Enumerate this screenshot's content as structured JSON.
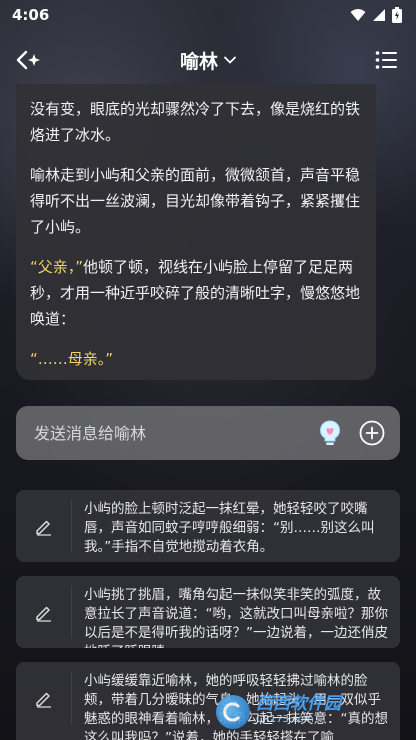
{
  "status": {
    "time": "4:06"
  },
  "header": {
    "title": "喻林"
  },
  "chat": {
    "paragraphs": [
      {
        "text": "没有变，眼底的光却骤然冷了下去，像是烧红的铁烙进了冰水。",
        "style": "normal"
      },
      {
        "text": "喻林走到小屿和父亲的面前，微微颔首，声音平稳得听不出一丝波澜，目光却像带着钩子，紧紧攫住了小屿。",
        "style": "normal"
      },
      {
        "quote": "“父亲，”",
        "text": "他顿了顿，视线在小屿脸上停留了足足两秒，才用一种近乎咬碎了般的清晰吐字，慢悠悠地唤道：",
        "style": "mixed"
      },
      {
        "text": "“……母亲。”",
        "style": "yellow"
      }
    ]
  },
  "input": {
    "placeholder": "发送消息给喻林"
  },
  "suggestions": [
    {
      "text": "小屿的脸上顿时泛起一抹红晕，她轻轻咬了咬嘴唇，声音如同蚊子哼哼般细弱：“别……别这么叫我。”手指不自觉地搅动着衣角。"
    },
    {
      "text": "小屿挑了挑眉，嘴角勾起一抹似笑非笑的弧度，故意拉长了声音说道：“哟，这就改口叫母亲啦？那你以后是不是得听我的话呀？”一边说着，一边还俏皮地眨了眨眼睛。"
    },
    {
      "text": "小屿缓缓靠近喻林，她的呼吸轻轻拂过喻林的脸颊，带着几分暧昧的气息，她抬起头，用一双似乎魅惑的眼神看着喻林，嘴角勾起一抹笑意：“真的想这么叫我吗？”说着，她的手轻轻搭在了喻"
    }
  ],
  "watermark": {
    "main": "西西软件园",
    "sub": "CR173.com"
  },
  "colors": {
    "accent_quote": "#f5d26a",
    "bubble": "#303036",
    "input": "#78787c"
  }
}
